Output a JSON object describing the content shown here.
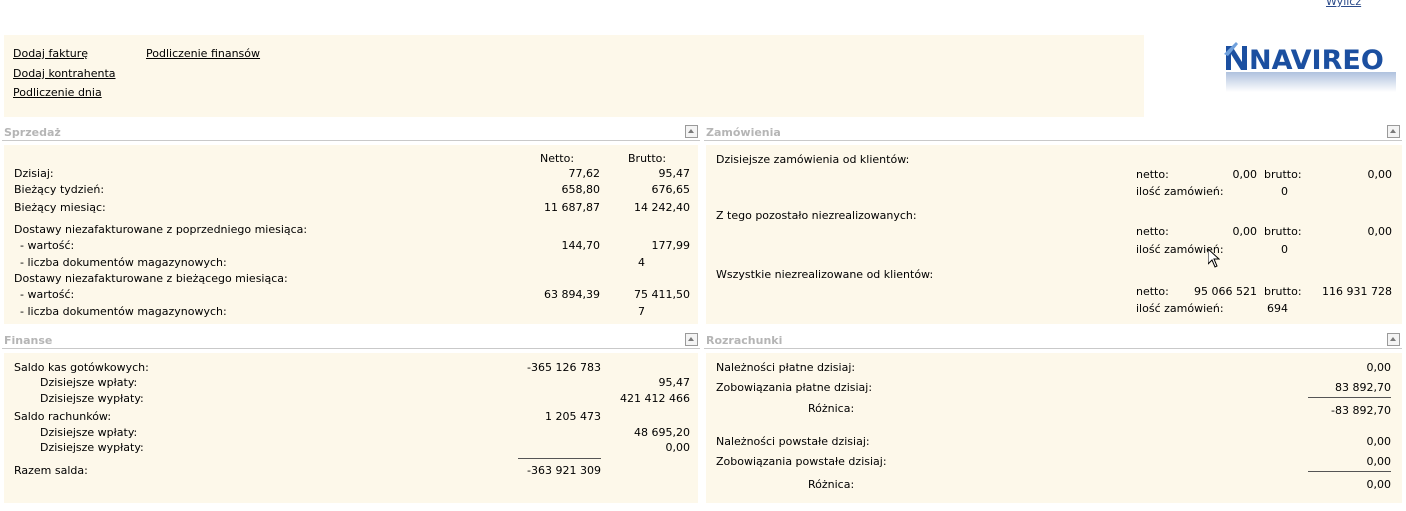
{
  "top": {
    "calc_link": "Wylicz"
  },
  "quick_links": {
    "add_invoice": "Dodaj fakturę",
    "add_contractor": "Dodaj kontrahenta",
    "day_settlement": "Podliczenie dnia",
    "finance_settlement": "Podliczenie finansów"
  },
  "logo": {
    "text": "NAVIREO"
  },
  "sales": {
    "title": "Sprzedaż",
    "col_net": "Netto:",
    "col_gross": "Brutto:",
    "rows": [
      {
        "label": "Dzisiaj:",
        "net": "77,62",
        "gross": "95,47"
      },
      {
        "label": "Bieżący tydzień:",
        "net": "658,80",
        "gross": "676,65"
      },
      {
        "label": "Bieżący miesiąc:",
        "net": "11 687,87",
        "gross": "14 242,40"
      }
    ],
    "prev_month_header": "Dostawy niezafakturowane z poprzedniego miesiąca:",
    "prev_value_label": "- wartość:",
    "prev_value_net": "144,70",
    "prev_value_gross": "177,99",
    "prev_docs_label": "- liczba dokumentów magazynowych:",
    "prev_docs_count": "4",
    "cur_month_header": "Dostawy niezafakturowane z bieżącego miesiąca:",
    "cur_value_label": "- wartość:",
    "cur_value_net": "63 894,39",
    "cur_value_gross": "75 411,50",
    "cur_docs_label": "- liczba dokumentów magazynowych:",
    "cur_docs_count": "7"
  },
  "orders": {
    "title": "Zamówienia",
    "today_header": "Dzisiejsze zamówienia od klientów:",
    "today_net_label": "netto:",
    "today_net": "0,00",
    "today_gross_label": "brutto:",
    "today_gross": "0,00",
    "today_count_label": "ilość zamówień:",
    "today_count": "0",
    "pending_header": "Z tego pozostało niezrealizowanych:",
    "pending_net_label": "netto:",
    "pending_net": "0,00",
    "pending_gross_label": "brutto:",
    "pending_gross": "0,00",
    "pending_count_label": "ilość zamówień:",
    "pending_count": "0",
    "all_header": "Wszystkie niezrealizowane od klientów:",
    "all_net_label": "netto:",
    "all_net": "95 066 521",
    "all_gross_label": "brutto:",
    "all_gross": "116 931 728",
    "all_count_label": "ilość zamówień:",
    "all_count": "694"
  },
  "finance": {
    "title": "Finanse",
    "cash_balance_label": "Saldo kas gotówkowych:",
    "cash_balance": "-365 126 783",
    "cash_in_label": "Dzisiejsze wpłaty:",
    "cash_in": "95,47",
    "cash_out_label": "Dzisiejsze wypłaty:",
    "cash_out": "421 412 466",
    "acc_balance_label": "Saldo rachunków:",
    "acc_balance": "1 205 473",
    "acc_in_label": "Dzisiejsze wpłaty:",
    "acc_in": "48 695,20",
    "acc_out_label": "Dzisiejsze wypłaty:",
    "acc_out": "0,00",
    "total_label": "Razem salda:",
    "total": "-363 921 309"
  },
  "settlements": {
    "title": "Rozrachunki",
    "recv_paid_label": "Należności płatne dzisiaj:",
    "recv_paid": "0,00",
    "liab_paid_label": "Zobowiązania płatne dzisiaj:",
    "liab_paid": "83 892,70",
    "diff1_label": "Różnica:",
    "diff1": "-83 892,70",
    "recv_new_label": "Należności powstałe dzisiaj:",
    "recv_new": "0,00",
    "liab_new_label": "Zobowiązania powstałe dzisiaj:",
    "liab_new": "0,00",
    "diff2_label": "Różnica:",
    "diff2": "0,00"
  }
}
